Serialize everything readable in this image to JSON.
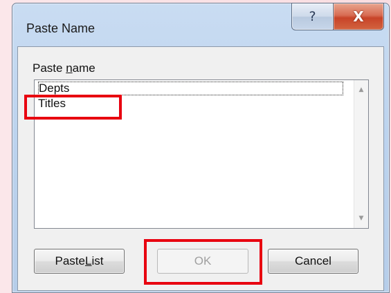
{
  "dialog": {
    "title": "Paste Name",
    "help_glyph": "?",
    "close_glyph": "X"
  },
  "field": {
    "label_prefix": "Paste ",
    "label_access": "n",
    "label_suffix": "ame"
  },
  "names": [
    {
      "label": "Depts"
    },
    {
      "label": "Titles"
    }
  ],
  "scroll": {
    "up_glyph": "▲",
    "down_glyph": "▼"
  },
  "buttons": {
    "paste_list_prefix": "Paste ",
    "paste_list_access": "L",
    "paste_list_suffix": "ist",
    "ok": "OK",
    "cancel": "Cancel"
  },
  "colors": {
    "highlight": "#e8000f",
    "close_button": "#c84428"
  }
}
